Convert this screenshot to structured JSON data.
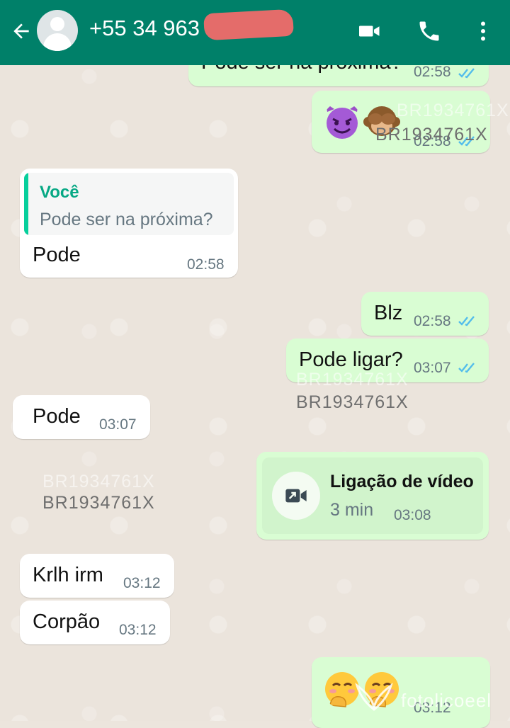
{
  "header": {
    "contact_name": "+55 34 963",
    "icons": [
      "back-arrow-icon",
      "avatar",
      "video-call-icon",
      "voice-call-icon",
      "more-options-icon"
    ],
    "color": "#008069"
  },
  "messages": {
    "m1": {
      "text": "Pode ser na próxima?",
      "time": "02:58"
    },
    "m2": {
      "emojis": [
        "smiling-devil-emoji",
        "see-no-evil-monkey-emoji"
      ],
      "time": "02:58"
    },
    "m3": {
      "reply_author": "Você",
      "reply_text": "Pode ser na próxima?",
      "text": "Pode",
      "time": "02:58"
    },
    "m4": {
      "text": "Blz",
      "time": "02:58"
    },
    "m5": {
      "text": "Pode ligar?",
      "time": "03:07"
    },
    "m6": {
      "text": "Pode",
      "time": "03:07"
    },
    "m7": {
      "title": "Ligação de vídeo",
      "duration": "3 min",
      "time": "03:08"
    },
    "m8": {
      "text": "Krlh irm",
      "time": "03:12"
    },
    "m9": {
      "text": "Corpão",
      "time": "03:12"
    },
    "m10": {
      "emojis": [
        "hand-over-mouth-emoji",
        "hand-over-mouth-emoji"
      ],
      "time": "03:12"
    }
  },
  "watermarks": {
    "code": "BR1934761X",
    "brand": "fotolicoeel"
  },
  "colors": {
    "outgoing_bubble": "#d9fdd3",
    "incoming_bubble": "#ffffff",
    "read_ticks": "#53bdeb",
    "reply_bar": "#06cf9c"
  }
}
